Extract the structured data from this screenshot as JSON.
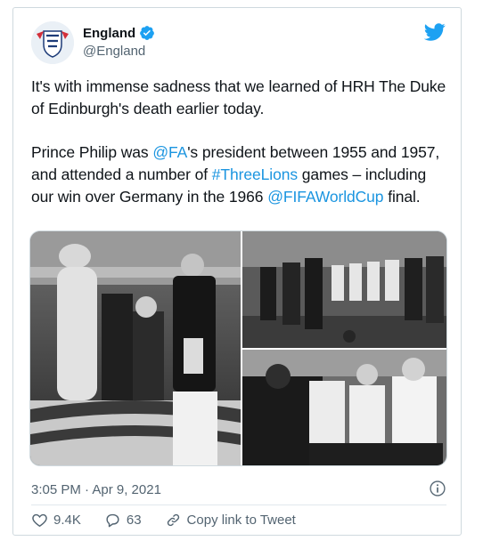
{
  "account": {
    "name": "England",
    "handle": "@England"
  },
  "tweet": {
    "line1": "It's with immense sadness that we learned of HRH The Duke of Edinburgh's death earlier today.",
    "p2_pre": "Prince Philip was ",
    "mention_fa": "@FA",
    "p2_mid1": "'s president between 1955 and 1957, and attended a number of ",
    "hashtag": "#ThreeLions",
    "p2_mid2": " games – including our win over Germany in the 1966 ",
    "mention_fifa": "@FIFAWorldCup",
    "p2_end": " final."
  },
  "meta": {
    "timestamp": "3:05 PM · Apr 9, 2021"
  },
  "actions": {
    "likes": "9.4K",
    "replies": "63",
    "copy_link": "Copy link to Tweet"
  },
  "colors": {
    "link": "#1b95e0",
    "twitter_blue": "#1da1f2",
    "muted": "#536471"
  },
  "icons": [
    "england-crest-icon",
    "verified-badge-icon",
    "twitter-bird-icon",
    "info-icon",
    "heart-icon",
    "reply-icon",
    "link-icon"
  ]
}
